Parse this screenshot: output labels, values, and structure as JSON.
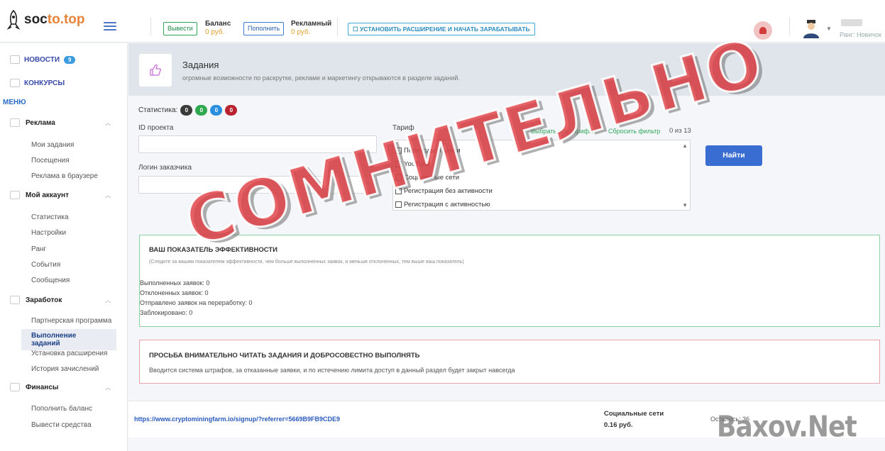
{
  "header": {
    "logo_a": "soc",
    "logo_b": "to.top",
    "withdraw_btn": "Вывести",
    "balance_label": "Баланс",
    "balance_value": "0 руб.",
    "topup_btn": "Пополнить",
    "ad_label": "Рекламный",
    "ad_value": "0 руб.",
    "extension_btn": "☐ УСТАНОВИТЬ РАСШИРЕНИЕ И НАЧАТЬ ЗАРАБАТЫВАТЬ",
    "rank": "Ранг: Новичок"
  },
  "sidebar": {
    "news": "НОВОСТИ",
    "news_count": "9",
    "contests": "КОНКУРСЫ",
    "menu": "МЕНЮ",
    "sections": [
      {
        "title": "Реклама",
        "items": [
          "Мои задания",
          "Посещения",
          "Реклама в браузере"
        ]
      },
      {
        "title": "Мой аккаунт",
        "items": [
          "Статистика",
          "Настройки",
          "Ранг",
          "События",
          "Сообщения"
        ]
      },
      {
        "title": "Заработок",
        "items": [
          "Партнерская программа",
          "Выполнение заданий",
          "Установка расширения",
          "История зачислений"
        ]
      },
      {
        "title": "Финансы",
        "items": [
          "Пополнить баланс",
          "Вывести средства"
        ]
      }
    ]
  },
  "page": {
    "title": "Задания",
    "subtitle": "огромные возможности по раскрутке, рекламе и маркетингу открываются в разделе заданий."
  },
  "filters": {
    "stats_label": "Статистика:",
    "stat_badges": [
      {
        "value": "0",
        "color": "#3a3a3a"
      },
      {
        "value": "0",
        "color": "#2fa84f"
      },
      {
        "value": "0",
        "color": "#2b8fe0"
      },
      {
        "value": "0",
        "color": "#b8232f"
      }
    ],
    "project_id_label": "ID проекта",
    "customer_login_label": "Логин заказчика",
    "tariff_label": "Тариф",
    "select_all": "Выбрать все тарифы",
    "reset_filter": "Сбросить фильтр",
    "count": "0 из 13",
    "tariffs": [
      "Переходы и клики",
      "YouTube",
      "Социальные сети",
      "Регистрация без активности",
      "Регистрация с активностью"
    ],
    "find_btn": "Найти"
  },
  "efficiency": {
    "title": "ВАШ ПОКАЗАТЕЛЬ ЭФФЕКТИВНОСТИ",
    "note": "(Следите за вашим показателем эффективности, чем больше выполненных заявок, и меньше отклоненных, тем выше ваш показатель)",
    "done": "Выполненных заявок: 0",
    "rejected": "Отклоненных заявок: 0",
    "rework": "Отправлено заявок на переработку: 0",
    "blocked": "Заблокировано: 0"
  },
  "warning": {
    "title": "ПРОСЬБА ВНИМАТЕЛЬНО ЧИТАТЬ ЗАДАНИЯ И ДОБРОСОВЕСТНО ВЫПОЛНЯТЬ",
    "text": "Вводится система штрафов, за отказанные заявки, и по истечению лимита доступ в данный раздел будет закрыт навсегда"
  },
  "task": {
    "link": "https://www.cryptominingfarm.io/signup/?referrer=5669B9FB9CDE9",
    "category": "Социальные сети",
    "price": "0.16 руб.",
    "left": "Осталось: 36"
  },
  "watermark": {
    "stamp": "СОМНИТЕЛЬНО",
    "brand": "Baxov.Net"
  }
}
